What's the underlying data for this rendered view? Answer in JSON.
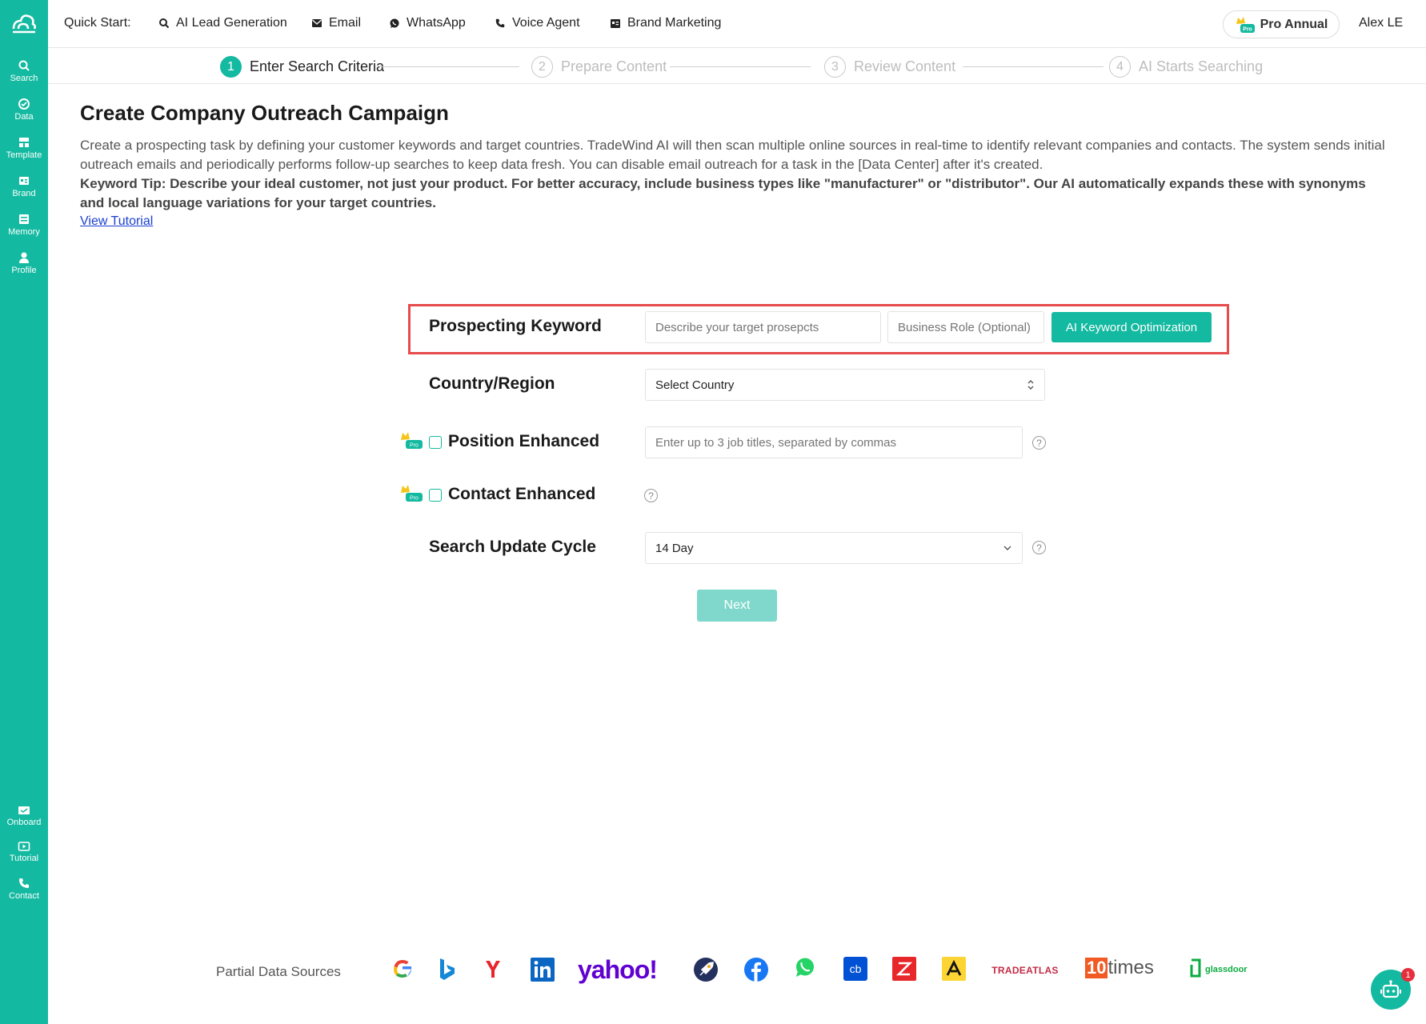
{
  "sidebar": {
    "items": [
      {
        "label": "Search",
        "icon": "search-icon"
      },
      {
        "label": "Data",
        "icon": "data-icon"
      },
      {
        "label": "Template",
        "icon": "template-icon"
      },
      {
        "label": "Brand",
        "icon": "brand-icon"
      },
      {
        "label": "Memory",
        "icon": "memory-icon"
      },
      {
        "label": "Profile",
        "icon": "profile-icon"
      }
    ],
    "bottom_items": [
      {
        "label": "Onboard",
        "icon": "onboard-icon"
      },
      {
        "label": "Tutorial",
        "icon": "tutorial-icon"
      },
      {
        "label": "Contact",
        "icon": "phone-icon"
      }
    ]
  },
  "topbar": {
    "quick_start_label": "Quick Start:",
    "items": [
      {
        "label": "AI Lead Generation",
        "icon": "search-icon"
      },
      {
        "label": "Email",
        "icon": "mail-icon"
      },
      {
        "label": "WhatsApp",
        "icon": "whatsapp-icon"
      },
      {
        "label": "Voice Agent",
        "icon": "phone-icon"
      },
      {
        "label": "Brand Marketing",
        "icon": "brand-icon"
      }
    ],
    "plan_label": "Pro Annual",
    "user_name": "Alex LE"
  },
  "stepper": {
    "steps": [
      {
        "number": "1",
        "label": "Enter Search Criteria",
        "active": true
      },
      {
        "number": "2",
        "label": "Prepare Content",
        "active": false
      },
      {
        "number": "3",
        "label": "Review Content",
        "active": false
      },
      {
        "number": "4",
        "label": "AI Starts Searching",
        "active": false
      }
    ]
  },
  "main": {
    "title": "Create Company Outreach Campaign",
    "description": "Create a prospecting task by defining your customer keywords and target countries. TradeWind AI will then scan multiple online sources in real-time to identify relevant companies and contacts. The system sends initial outreach emails and periodically performs follow-up searches to keep data fresh. You can disable email outreach for a task in the [Data Center] after it's created.",
    "tip": "Keyword Tip: Describe your ideal customer, not just your product. For better accuracy, include business types like \"manufacturer\" or \"distributor\". Our AI automatically expands these with synonyms and local language variations for your target countries.",
    "tutorial_link": "View Tutorial"
  },
  "form": {
    "keyword_label": "Prospecting Keyword",
    "keyword_placeholder": "Describe your target prosepcts",
    "role_placeholder": "Business Role (Optional)",
    "ai_button": "AI Keyword Optimization",
    "country_label": "Country/Region",
    "country_value": "Select Country",
    "position_label": "Position Enhanced",
    "position_placeholder": "Enter up to 3 job titles, separated by commas",
    "contact_label": "Contact Enhanced",
    "cycle_label": "Search Update Cycle",
    "cycle_value": "14 Day",
    "next_button": "Next",
    "pro_badge": "Pro",
    "help_glyph": "?"
  },
  "data_sources": {
    "label": "Partial Data Sources",
    "logos": [
      "google",
      "bing",
      "yandex",
      "linkedin",
      "yahoo",
      "rocketreach",
      "facebook",
      "whatsapp",
      "crunchbase",
      "zoominfo",
      "apollo",
      "tradeatlas",
      "10times",
      "glassdoor"
    ],
    "yahoo_text": "yahoo!",
    "tradeatlas_text": "TRADEATLAS",
    "tentimes_num": "10",
    "tentimes_text": "times",
    "glassdoor_text": "glassdoor",
    "cb_text": "cb"
  },
  "chat": {
    "badge": "1"
  },
  "colors": {
    "brand": "#13b9a0",
    "highlight": "#e84b4b",
    "next_disabled": "#7fd8cb"
  }
}
